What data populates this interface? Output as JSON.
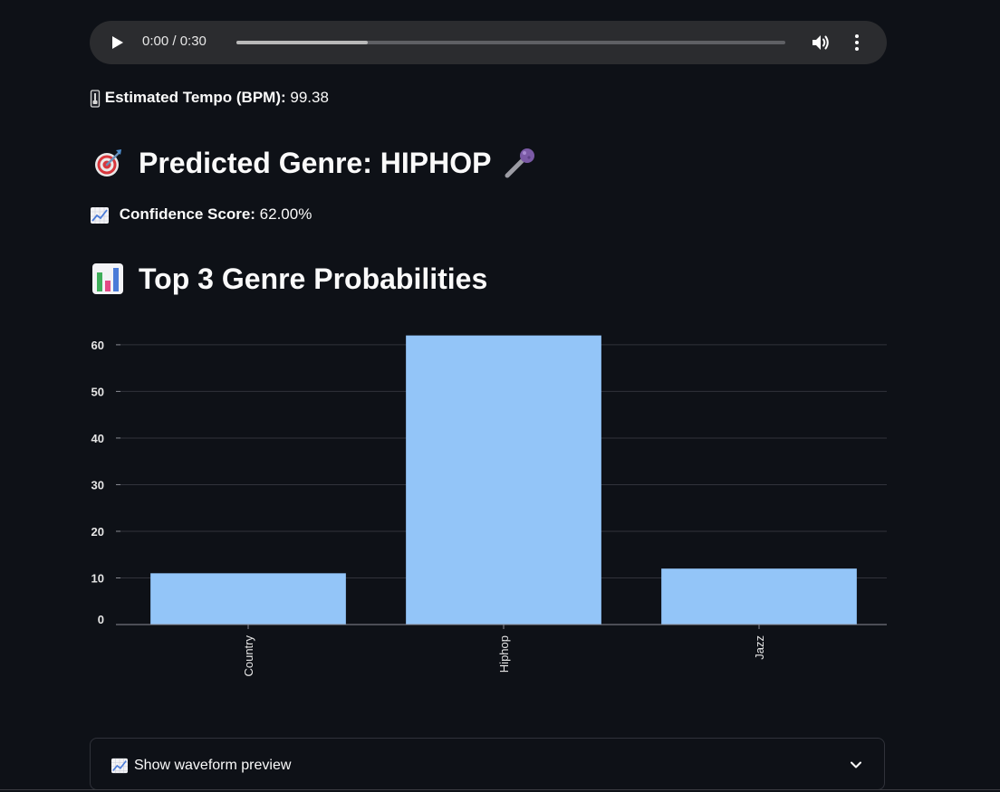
{
  "audio": {
    "time_display": "0:00 / 0:30",
    "progress_fraction": 0.24
  },
  "tempo": {
    "label": "Estimated Tempo (BPM):",
    "value": "99.38"
  },
  "prediction": {
    "heading": "Predicted Genre: HIPHOP"
  },
  "confidence": {
    "label": "Confidence Score:",
    "value": "62.00%"
  },
  "probabilities": {
    "heading": "Top 3 Genre Probabilities"
  },
  "chart_data": {
    "type": "bar",
    "title": "",
    "xlabel": "",
    "ylabel": "",
    "categories": [
      "Country",
      "Hiphop",
      "Jazz"
    ],
    "values": [
      11,
      62,
      12
    ],
    "ylim": [
      0,
      66
    ],
    "yticks": [
      0,
      10,
      20,
      30,
      40,
      50,
      60
    ],
    "grid": true,
    "bar_color": "#93c5f8",
    "grid_color": "#31333b",
    "tick_color": "#e6e6e6"
  },
  "waveform_expander": {
    "label": "Show waveform preview"
  },
  "colors": {
    "background": "#0e1117",
    "text": "#fafafa",
    "player_bg": "#2b2c2f"
  },
  "icons": [
    "play-icon",
    "volume-icon",
    "more-vertical-icon",
    "thermometer-icon",
    "target-icon",
    "microphone-icon",
    "chart-increasing-icon",
    "bar-chart-icon",
    "chevron-down-icon"
  ]
}
